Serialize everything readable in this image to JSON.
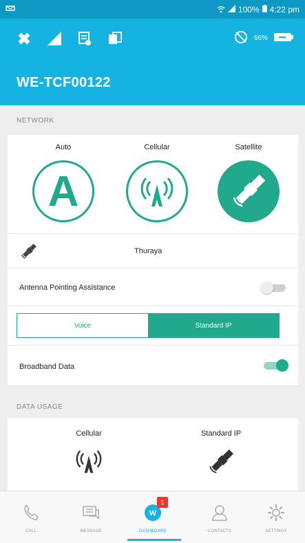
{
  "statusbar": {
    "left_icon": "notification-icon",
    "battery": "100%",
    "time": "4:22 pm"
  },
  "appbar": {
    "title": "WE-TCF00122",
    "battery_percent": "96%"
  },
  "network": {
    "section_label": "NETWORK",
    "modes": [
      {
        "label": "Auto",
        "glyph": "A"
      },
      {
        "label": "Cellular"
      },
      {
        "label": "Satellite"
      }
    ],
    "provider": "Thuraya",
    "antenna_label": "Antenna Pointing Assistance",
    "antenna_on": false,
    "segment": {
      "voice": "Voice",
      "standard_ip": "Standard IP",
      "selected": "standard_ip"
    },
    "broadband_label": "Broadband Data",
    "broadband_on": true
  },
  "data_usage": {
    "section_label": "DATA USAGE",
    "columns": [
      {
        "label": "Cellular"
      },
      {
        "label": "Standard IP"
      }
    ]
  },
  "bottom_nav": {
    "items": [
      {
        "label": "CALL",
        "icon": "phone-icon"
      },
      {
        "label": "MESSAGE",
        "icon": "message-icon"
      },
      {
        "label": "DASHBOARD",
        "icon": "dashboard-icon",
        "badge": "1"
      },
      {
        "label": "CONTACTS",
        "icon": "contacts-icon"
      },
      {
        "label": "SETTINGS",
        "icon": "settings-icon"
      }
    ]
  },
  "colors": {
    "primary": "#14b3e0",
    "accent": "#21a98d",
    "badge": "#e8392b"
  }
}
